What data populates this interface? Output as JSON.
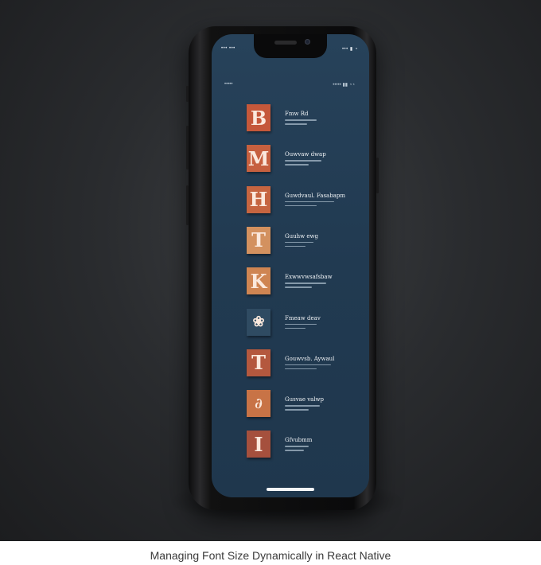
{
  "caption": "Managing Font Size Dynamically in React Native",
  "status_bar": {
    "left": "•••  •••",
    "right": "•••  ▮ ◔"
  },
  "header": {
    "left": "•••••",
    "right": "••••• ▮▮ ◔◔"
  },
  "items": [
    {
      "glyph": "B",
      "title": "Fmw Rd",
      "icon": "letter-b-icon",
      "color": "#c5583a"
    },
    {
      "glyph": "M",
      "title": "Ouwvaw dwap",
      "icon": "letter-m-icon",
      "color": "#c6603f"
    },
    {
      "glyph": "H",
      "title": "Guwdvaul. Fasabapm",
      "icon": "letter-h-icon",
      "color": "#c66540"
    },
    {
      "glyph": "T",
      "title": "Guuhw ewg",
      "icon": "letter-t-icon",
      "color": "#d3915f"
    },
    {
      "glyph": "K",
      "title": "Exwwvwsafsbaw",
      "icon": "letter-k-icon",
      "color": "#cf8552"
    },
    {
      "glyph": "❀",
      "title": "Fmeaw deav",
      "icon": "floral-pattern-icon",
      "color": "#2f4b62"
    },
    {
      "glyph": "T",
      "title": "Gouwvsb. Aywaul",
      "icon": "letter-t-icon",
      "color": "#b4583e"
    },
    {
      "glyph": "∂",
      "title": "Gusvae valwp",
      "icon": "script-swash-icon",
      "color": "#c87346"
    },
    {
      "glyph": "I",
      "title": "Gfvubmm",
      "icon": "letter-i-icon",
      "color": "#a5503d"
    }
  ]
}
